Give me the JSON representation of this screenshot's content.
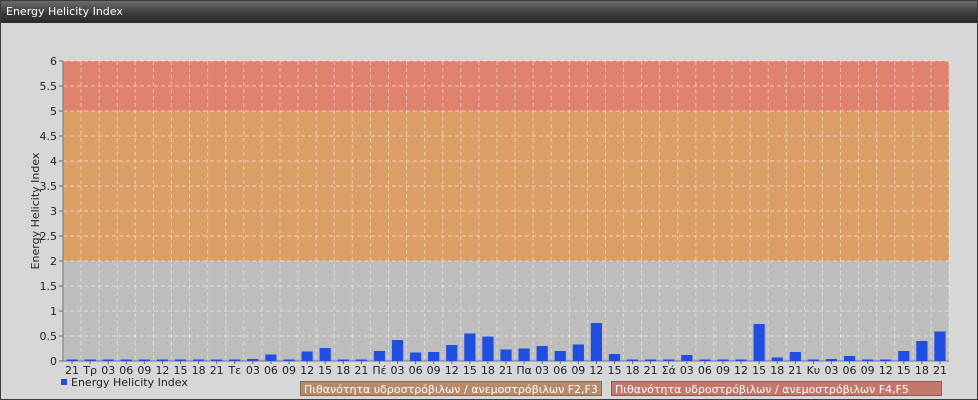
{
  "window": {
    "title": "Energy Helicity Index"
  },
  "colors": {
    "bar": "#1f4ee0",
    "band_low": "#bdbdbd",
    "band_mid": "#dc9e67",
    "band_high": "#e0836e",
    "legend_f2f3": "#b98a6a",
    "legend_f4f5": "#c4776a"
  },
  "legend": {
    "series_label": "Energy Helicity Index",
    "zone_f2f3": "Πιθανότητα υδροστρόβιλων / ανεμοστρόβιλων F2,F3",
    "zone_f4f5": "Πιθανότητα υδροστρόβιλων / ανεμοστρόβιλων F4,F5"
  },
  "chart_data": {
    "type": "bar",
    "title": "",
    "xlabel": "",
    "ylabel": "Energy Helicity Index",
    "ylim": [
      0,
      6
    ],
    "yticks": [
      "0",
      "0.5",
      "1",
      "1.5",
      "2",
      "2.5",
      "3",
      "3.5",
      "4",
      "4.5",
      "5",
      "5.5",
      "6"
    ],
    "grid": true,
    "legend_position": "bottom-left",
    "bands": [
      {
        "from": 0,
        "to": 2,
        "zone": "low"
      },
      {
        "from": 2,
        "to": 5,
        "zone": "F2,F3"
      },
      {
        "from": 5,
        "to": 6,
        "zone": "F4,F5"
      }
    ],
    "categories": [
      "21",
      "Τρ",
      "03",
      "06",
      "09",
      "12",
      "15",
      "18",
      "21",
      "Τε",
      "03",
      "06",
      "09",
      "12",
      "15",
      "18",
      "21",
      "Πέ",
      "03",
      "06",
      "09",
      "12",
      "15",
      "18",
      "21",
      "Πα",
      "03",
      "06",
      "09",
      "12",
      "15",
      "18",
      "21",
      "Σά",
      "03",
      "06",
      "09",
      "12",
      "15",
      "18",
      "21",
      "Κυ",
      "03",
      "06",
      "09",
      "12",
      "15",
      "18",
      "21"
    ],
    "series": [
      {
        "name": "Energy Helicity Index",
        "values": [
          0.03,
          0.02,
          0.02,
          0.02,
          0.02,
          0.01,
          0.01,
          0.01,
          0.01,
          0.01,
          0.04,
          0.13,
          0.02,
          0.19,
          0.26,
          0.01,
          0.01,
          0.2,
          0.42,
          0.17,
          0.18,
          0.32,
          0.55,
          0.49,
          0.23,
          0.25,
          0.3,
          0.2,
          0.33,
          0.76,
          0.14,
          0.02,
          0.02,
          0.01,
          0.12,
          0.02,
          0.02,
          0.01,
          0.74,
          0.07,
          0.18,
          0.03,
          0.04,
          0.1,
          0.02,
          0.01,
          0.2,
          0.4,
          0.59
        ]
      }
    ]
  }
}
